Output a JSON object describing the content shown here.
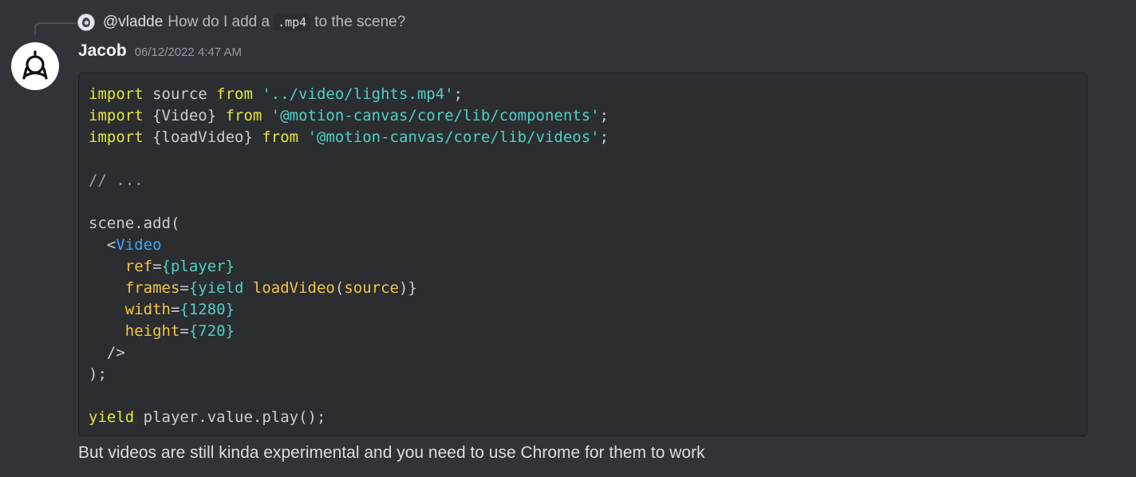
{
  "reply": {
    "username": "@vladde",
    "text_before": "How do I add a",
    "code": ".mp4",
    "text_after": "to the scene?"
  },
  "author": {
    "name": "Jacob",
    "timestamp": "06/12/2022 4:47 AM",
    "avatar_icon": "motion-canvas-logo-icon"
  },
  "code": {
    "l1": {
      "kw1": "import",
      "ident": " source ",
      "kw2": "from",
      "str": " '../video/lights.mp4'",
      "end": ";"
    },
    "l2": {
      "kw1": "import",
      "ident": " {Video} ",
      "kw2": "from",
      "str": " '@motion-canvas/core/lib/components'",
      "end": ";"
    },
    "l3": {
      "kw1": "import",
      "ident": " {loadVideo} ",
      "kw2": "from",
      "str": " '@motion-canvas/core/lib/videos'",
      "end": ";"
    },
    "l5": "// ...",
    "l7": "scene.add(",
    "l8": {
      "open": "  <",
      "tag": "Video"
    },
    "l9": {
      "attr": "    ref",
      "eq": "=",
      "val": "{player}"
    },
    "l10": {
      "attr": "    frames",
      "eq": "=",
      "v1": "{yield ",
      "fn": "loadVideo",
      "p1": "(",
      "arg": "source",
      "p2": ")",
      "v2": "}"
    },
    "l11": {
      "attr": "    width",
      "eq": "=",
      "val": "{1280}"
    },
    "l12": {
      "attr": "    height",
      "eq": "=",
      "val": "{720}"
    },
    "l13": "  />",
    "l14": ");",
    "l16": {
      "kw": "yield",
      "rest": " player.value.play();"
    }
  },
  "message": "But videos are still kinda experimental and you need to use Chrome for them to work"
}
